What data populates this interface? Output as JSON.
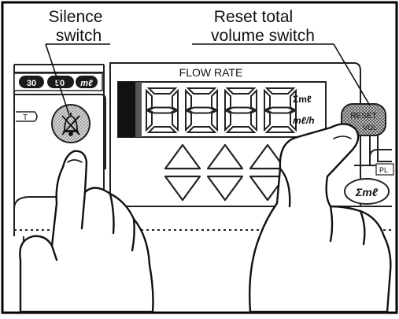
{
  "callouts": {
    "silence_line1": "Silence",
    "silence_line2": "switch",
    "reset_line1": "Reset total",
    "reset_line2": "volume switch"
  },
  "panel": {
    "flow_rate_label": "FLOW RATE",
    "display_digits": [
      "8",
      "8",
      "8",
      "8"
    ],
    "unit_total": "Σmℓ",
    "unit_rate": "mℓ/h",
    "reset_label_line1": "RESET",
    "reset_label_line2": "VOL",
    "sigma_button_label": "Σmℓ",
    "pl_label": "PL",
    "volume_chips": [
      "30",
      "50",
      "mℓ"
    ],
    "left_key_label": "T"
  },
  "icons": {
    "silence": "crossed-bell-icon",
    "hand": "pointing-hand-icon"
  }
}
